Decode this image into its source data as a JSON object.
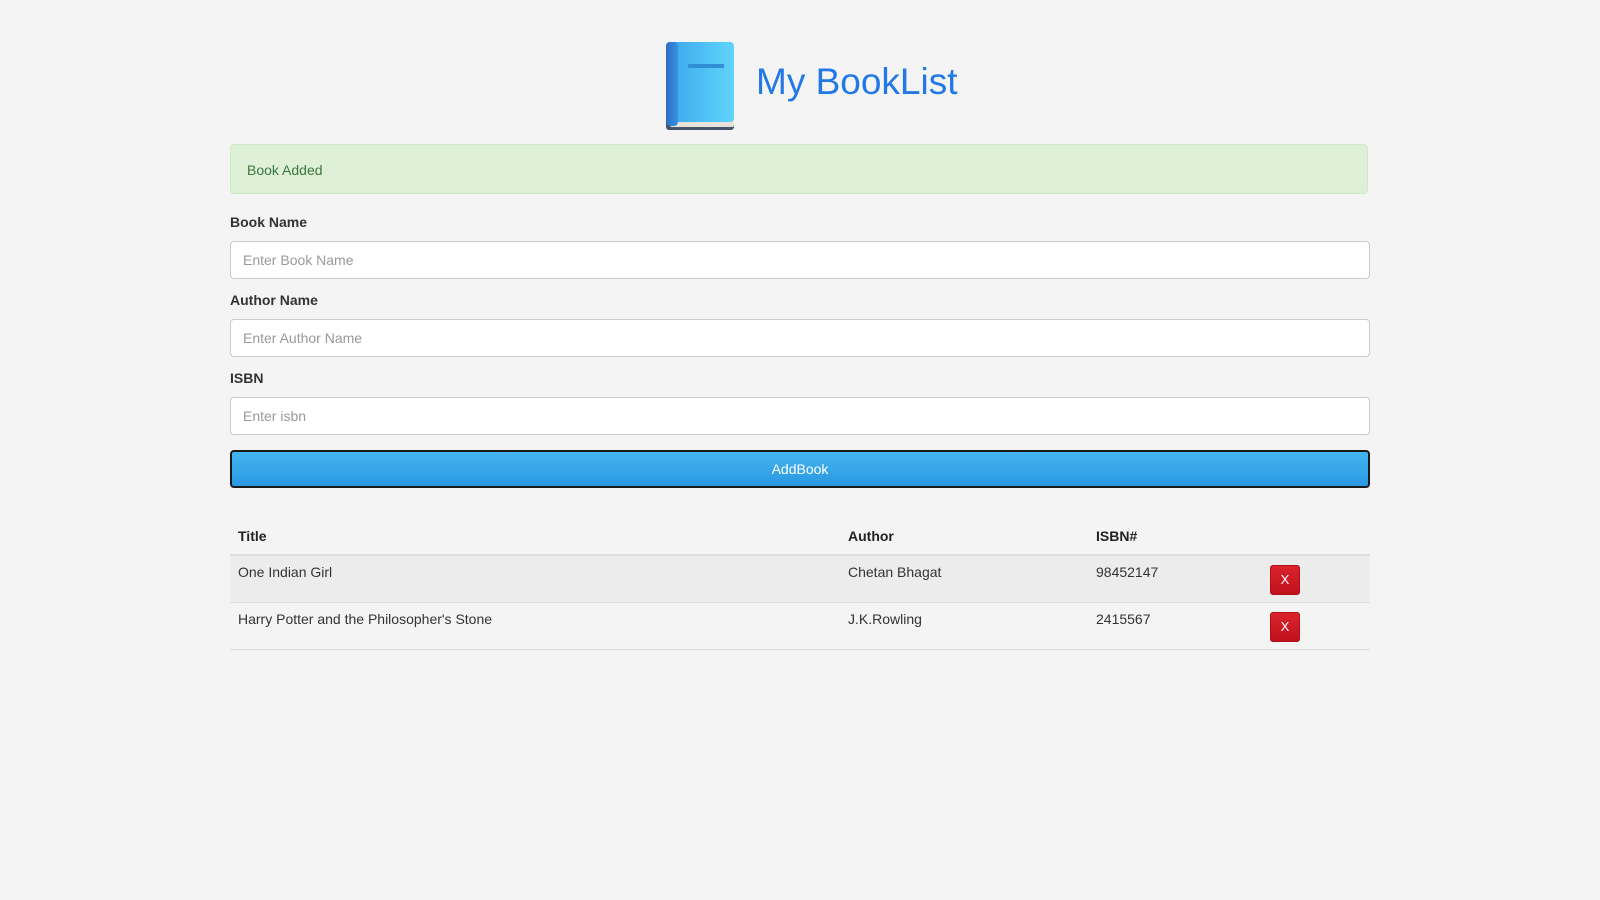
{
  "header": {
    "title": "My BookList",
    "logo_icon": "blue-book-icon"
  },
  "alert": {
    "message": "Book Added",
    "type": "success"
  },
  "form": {
    "book_name": {
      "label": "Book Name",
      "placeholder": "Enter Book Name",
      "value": ""
    },
    "author_name": {
      "label": "Author Name",
      "placeholder": "Enter Author Name",
      "value": ""
    },
    "isbn": {
      "label": "ISBN",
      "placeholder": "Enter isbn",
      "value": ""
    },
    "submit_label": "AddBook"
  },
  "table": {
    "headers": [
      "Title",
      "Author",
      "ISBN#",
      ""
    ],
    "rows": [
      {
        "title": "One Indian Girl",
        "author": "Chetan Bhagat",
        "isbn": "98452147",
        "delete_label": "X"
      },
      {
        "title": "Harry Potter and the Philosopher's Stone",
        "author": "J.K.Rowling",
        "isbn": "2415567",
        "delete_label": "X"
      }
    ]
  },
  "colors": {
    "title": "#2178e6",
    "alert_bg": "#dff0d8",
    "alert_text": "#3c763d",
    "button": "#2a98e2",
    "delete_button": "#d0141e"
  }
}
